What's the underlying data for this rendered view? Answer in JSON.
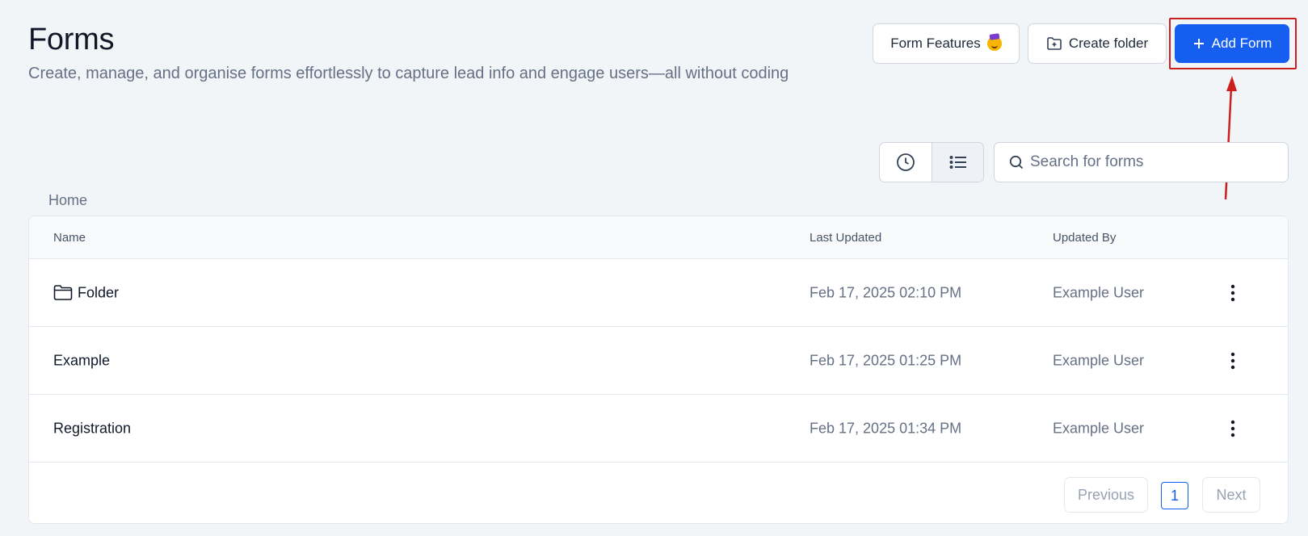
{
  "header": {
    "title": "Forms",
    "subtitle": "Create, manage, and organise forms effortlessly to capture lead info and engage users—all without coding"
  },
  "actions": {
    "features_label": "Form Features",
    "create_folder_label": "Create folder",
    "add_form_label": "Add Form"
  },
  "toolbar": {
    "search_placeholder": "Search for forms",
    "active_view": "list"
  },
  "breadcrumb": "Home",
  "table": {
    "columns": [
      "Name",
      "Last Updated",
      "Updated By"
    ],
    "rows": [
      {
        "name": "Folder",
        "type": "folder",
        "updated": "Feb 17, 2025 02:10 PM",
        "by": "Example User"
      },
      {
        "name": "Example",
        "type": "form",
        "updated": "Feb 17, 2025 01:25 PM",
        "by": "Example User"
      },
      {
        "name": "Registration",
        "type": "form",
        "updated": "Feb 17, 2025 01:34 PM",
        "by": "Example User"
      }
    ]
  },
  "pagination": {
    "previous_label": "Previous",
    "current_page": "1",
    "next_label": "Next"
  },
  "colors": {
    "primary": "#155eef",
    "annotation": "#cc1f1f",
    "background": "#f1f5f8"
  }
}
